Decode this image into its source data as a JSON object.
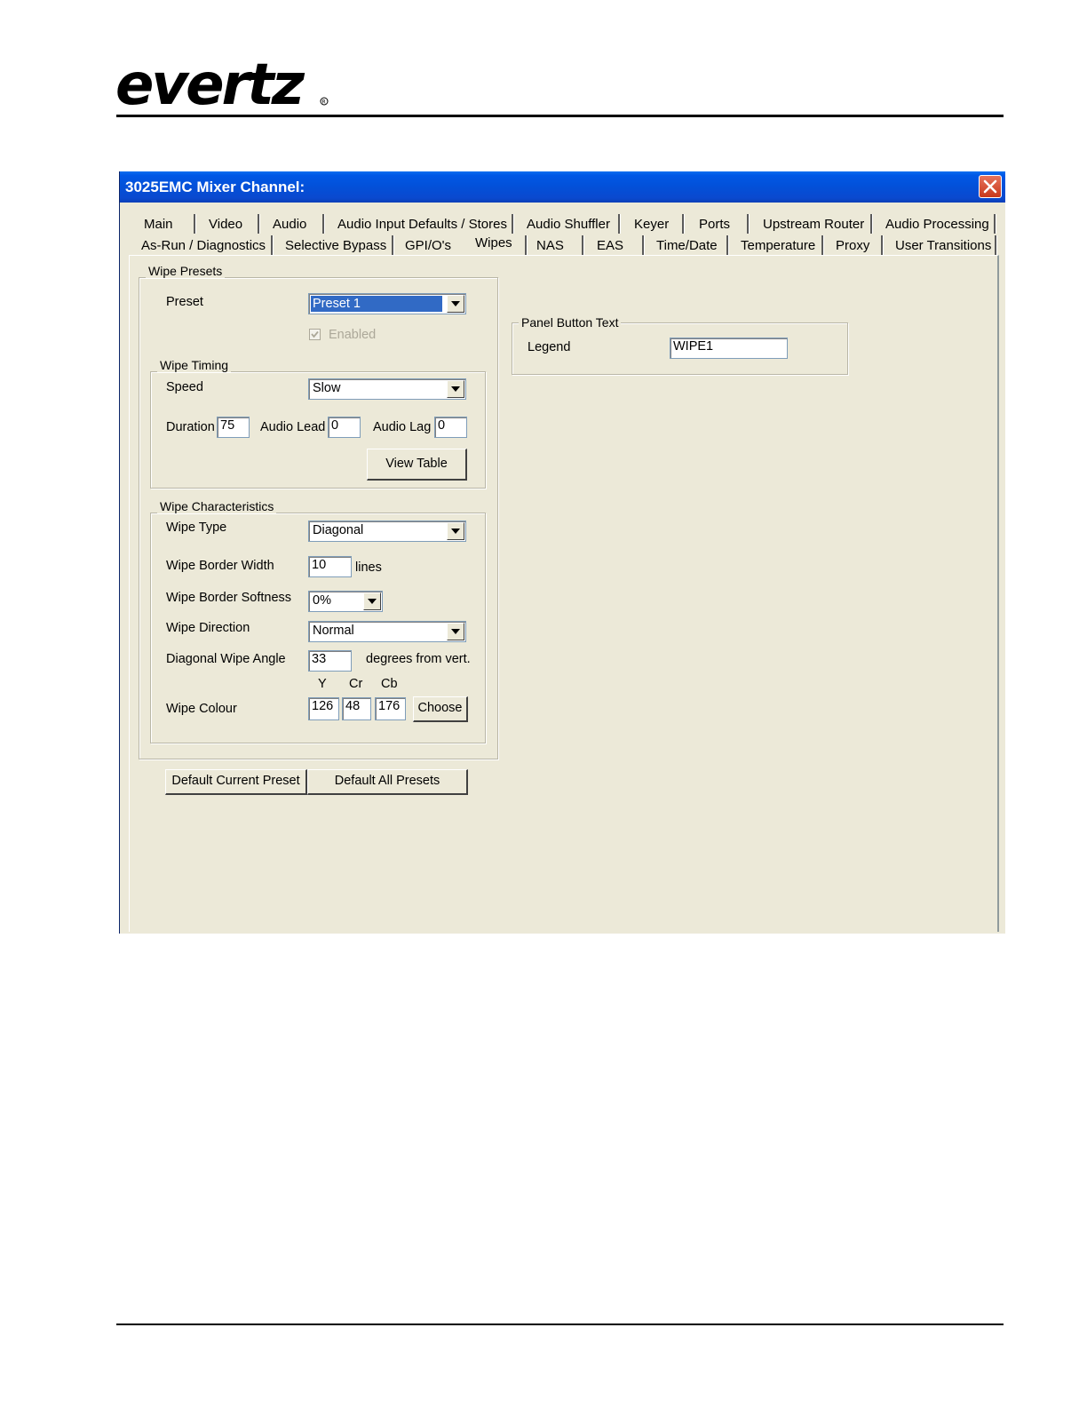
{
  "brand": {
    "logo_text": "evertz"
  },
  "window": {
    "title": "3025EMC Mixer Channel:",
    "tabs_row1": [
      "Main",
      "Video",
      "Audio",
      "Audio Input Defaults / Stores",
      "Audio Shuffler",
      "Keyer",
      "Ports",
      "Upstream Router",
      "Audio Processing"
    ],
    "tabs_row2": [
      "As-Run / Diagnostics",
      "Selective Bypass",
      "GPI/O's",
      "Wipes",
      "NAS",
      "EAS",
      "Time/Date",
      "Temperature",
      "Proxy",
      "User Transitions"
    ],
    "active_tab": "Wipes"
  },
  "wipe_presets": {
    "legend": "Wipe Presets",
    "preset_label": "Preset",
    "preset_value": "Preset 1",
    "enabled_label": "Enabled",
    "enabled_checked": true
  },
  "wipe_timing": {
    "legend": "Wipe Timing",
    "speed_label": "Speed",
    "speed_value": "Slow",
    "duration_label": "Duration",
    "duration_value": "75",
    "audio_lead_label": "Audio Lead",
    "audio_lead_value": "0",
    "audio_lag_label": "Audio Lag",
    "audio_lag_value": "0",
    "view_table_label": "View Table"
  },
  "wipe_characteristics": {
    "legend": "Wipe Characteristics",
    "type_label": "Wipe Type",
    "type_value": "Diagonal",
    "border_width_label": "Wipe Border Width",
    "border_width_value": "10",
    "border_width_unit": "lines",
    "border_softness_label": "Wipe Border Softness",
    "border_softness_value": "0%",
    "direction_label": "Wipe Direction",
    "direction_value": "Normal",
    "angle_label": "Diagonal Wipe Angle",
    "angle_value": "33",
    "angle_unit": "degrees from vert.",
    "colour_label": "Wipe Colour",
    "y_label": "Y",
    "cr_label": "Cr",
    "cb_label": "Cb",
    "y_value": "126",
    "cr_value": "48",
    "cb_value": "176",
    "choose_label": "Choose"
  },
  "panel_button_text": {
    "legend": "Panel Button Text",
    "legend_label": "Legend",
    "legend_value": "WIPE1"
  },
  "buttons": {
    "default_current": "Default Current Preset",
    "default_all": "Default All Presets"
  }
}
